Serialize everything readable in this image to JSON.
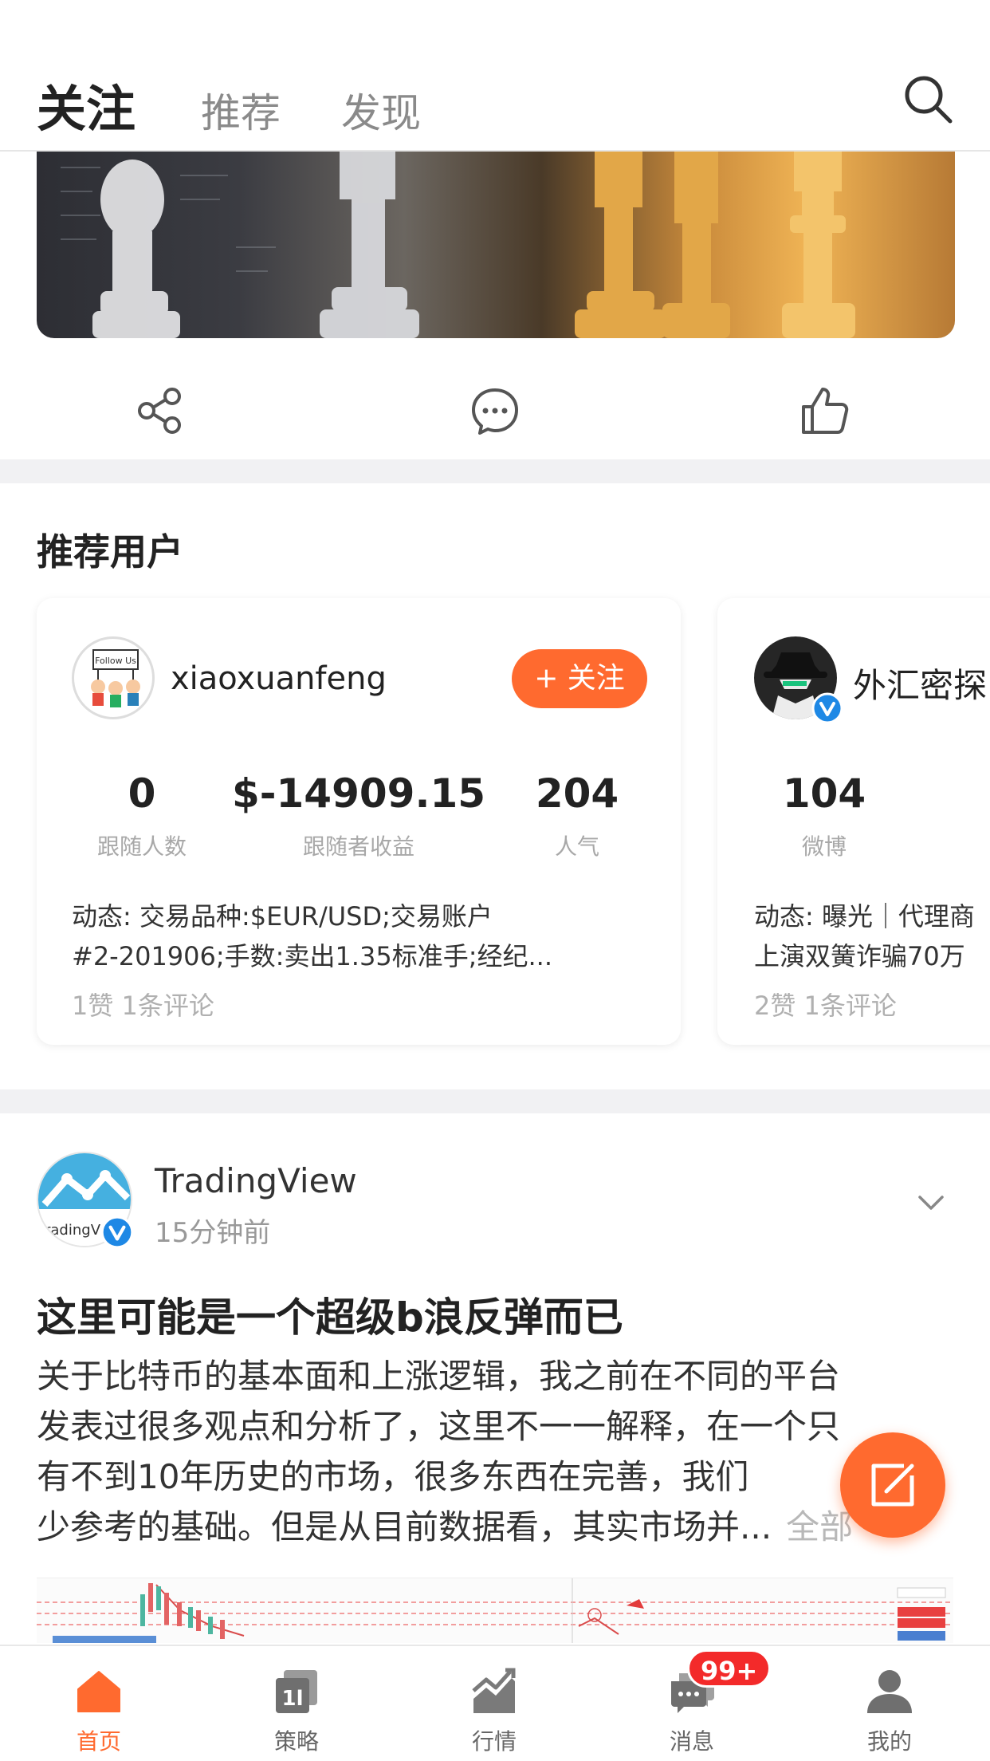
{
  "header": {
    "tabs": [
      {
        "label": "关注",
        "active": true
      },
      {
        "label": "推荐",
        "active": false
      },
      {
        "label": "发现",
        "active": false
      }
    ],
    "search_icon": "search-icon"
  },
  "post_actions": {
    "share_icon": "share-icon",
    "comment_icon": "comment-icon",
    "like_icon": "thumbs-up-icon"
  },
  "recommend": {
    "title": "推荐用户",
    "users": [
      {
        "name": "xiaoxuanfeng",
        "follow_label": "+ 关注",
        "stats": [
          {
            "value": "0",
            "label": "跟随人数"
          },
          {
            "value": "$-14909.15",
            "label": "跟随者收益"
          },
          {
            "value": "204",
            "label": "人气"
          }
        ],
        "dynamic_line1": "动态: 交易品种:$EUR/USD;交易账户",
        "dynamic_line2": "#2-201906;手数:卖出1.35标准手;经纪...",
        "meta": "1赞  1条评论"
      },
      {
        "name": "外汇密探",
        "stats": [
          {
            "value": "104",
            "label": "微博"
          }
        ],
        "dynamic_line1": "动态: 曝光｜代理商",
        "dynamic_line2": "上演双簧诈骗70万",
        "meta": "2赞  1条评论"
      }
    ]
  },
  "post": {
    "author": "TradingView",
    "time": "15分钟前",
    "title": "这里可能是一个超级b浪反弹而已",
    "body_lines": [
      "关于比特币的基本面和上涨逻辑，我之前在不同的平台",
      "发表过很多观点和分析了，这里不一一解释，在一个只",
      "有不到10年历史的市场，很多东西在完善，我们",
      "少参考的基础。但是从目前数据看，其实市场并..."
    ],
    "more_label": "全部"
  },
  "fab_icon": "compose-icon",
  "bottom_nav": [
    {
      "label": "首页",
      "icon": "home-icon",
      "active": true
    },
    {
      "label": "策略",
      "icon": "strategy-icon",
      "active": false
    },
    {
      "label": "行情",
      "icon": "market-chart-icon",
      "active": false
    },
    {
      "label": "消息",
      "icon": "message-icon",
      "active": false,
      "badge": "99+"
    },
    {
      "label": "我的",
      "icon": "profile-icon",
      "active": false
    }
  ],
  "colors": {
    "accent": "#ff6a2f",
    "badge": "#f32a2a",
    "verified": "#1e88e5"
  }
}
